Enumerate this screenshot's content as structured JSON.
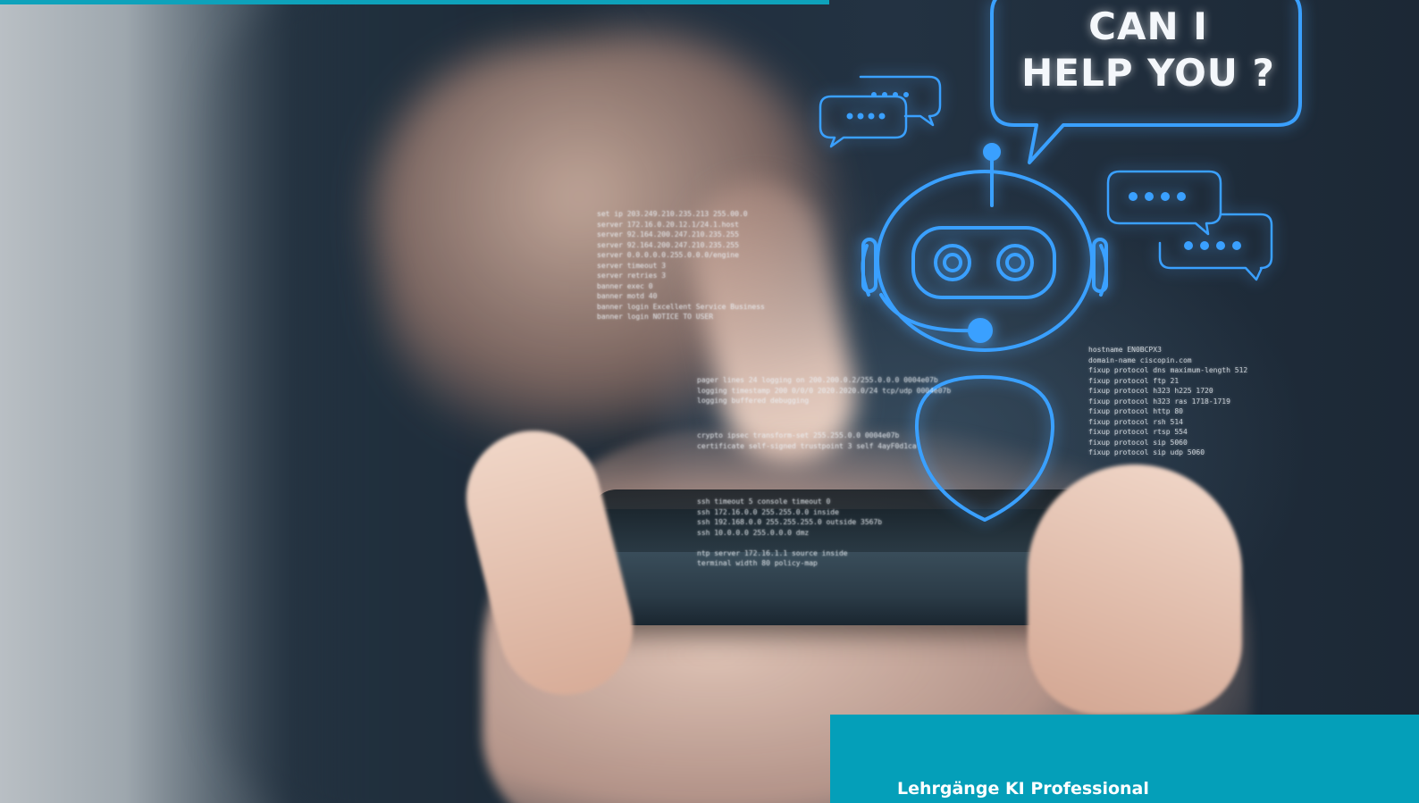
{
  "hero": {
    "bubble_line1": "CAN I",
    "bubble_line2": "HELP YOU ?",
    "chatbot_icon": "robot-chatbot-icon",
    "chat_icons": [
      "speech-bubble-icon",
      "speech-bubble-icon",
      "speech-bubble-icon",
      "speech-bubble-icon"
    ]
  },
  "code_blocks": {
    "block_a": "set ip 203.249.210.235.213 255.00.0\nserver 172.16.0.20.12.1/24.1.host\nserver 92.164.200.247.210.235.255\nserver 92.164.200.247.210.235.255\nserver 0.0.0.0.0.255.0.0.0/engine\nserver timeout 3\nserver retries 3\nbanner exec 0\nbanner motd 40\nbanner login Excellent Service Business\nbanner login NOTICE TO USER",
    "block_b": "hostname EN0BCPX3\ndomain-name ciscopin.com\nfixup protocol dns maximum-length 512\nfixup protocol ftp 21\nfixup protocol h323 h225 1720\nfixup protocol h323 ras 1718-1719\nfixup protocol http 80\nfixup protocol rsh 514\nfixup protocol rtsp 554\nfixup protocol sip 5060\nfixup protocol sip udp 5060",
    "block_c": "pager lines 24 logging on 200.200.0.2/255.0.0.0 0004e07b\nlogging timestamp 200 0/0/0 2020.2020.0/24 tcp/udp 0004e07b\nlogging buffered debugging",
    "block_d": "crypto ipsec transform-set 255.255.0.0 0004e07b\ncertificate self-signed trustpoint 3 self 4ayF0d1ca",
    "block_e": "ssh timeout 5 console timeout 0\nssh 172.16.0.0 255.255.0.0 inside\nssh 192.168.0.0 255.255.255.0 outside 3567b\nssh 10.0.0.0 255.0.0.0 dmz\n\nntp server 172.16.1.1 source inside\nterminal width 80 policy-map"
  },
  "panel": {
    "label": "Lehrgänge KI Professional"
  },
  "colors": {
    "accent_teal": "#049fb9",
    "hologram_blue": "#3aa0ff",
    "bubble_text": "#f4f7fb"
  }
}
